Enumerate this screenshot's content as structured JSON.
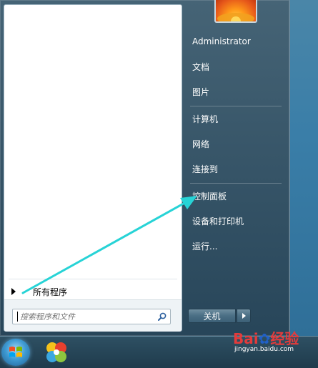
{
  "start_menu": {
    "all_programs_label": "所有程序",
    "search_placeholder": "搜索程序和文件",
    "user_name": "Administrator",
    "right_items": [
      {
        "label": "文档"
      },
      {
        "label": "图片"
      },
      {
        "label": "计算机"
      },
      {
        "label": "网络"
      },
      {
        "label": "连接到"
      },
      {
        "label": "控制面板"
      },
      {
        "label": "设备和打印机"
      },
      {
        "label": "运行..."
      }
    ],
    "shutdown_label": "关机"
  },
  "watermark": {
    "brand_left": "Bai",
    "brand_right": "经验",
    "url": "jingyan.baidu.com"
  },
  "colors": {
    "annotation_arrow": "#27d3d6"
  }
}
